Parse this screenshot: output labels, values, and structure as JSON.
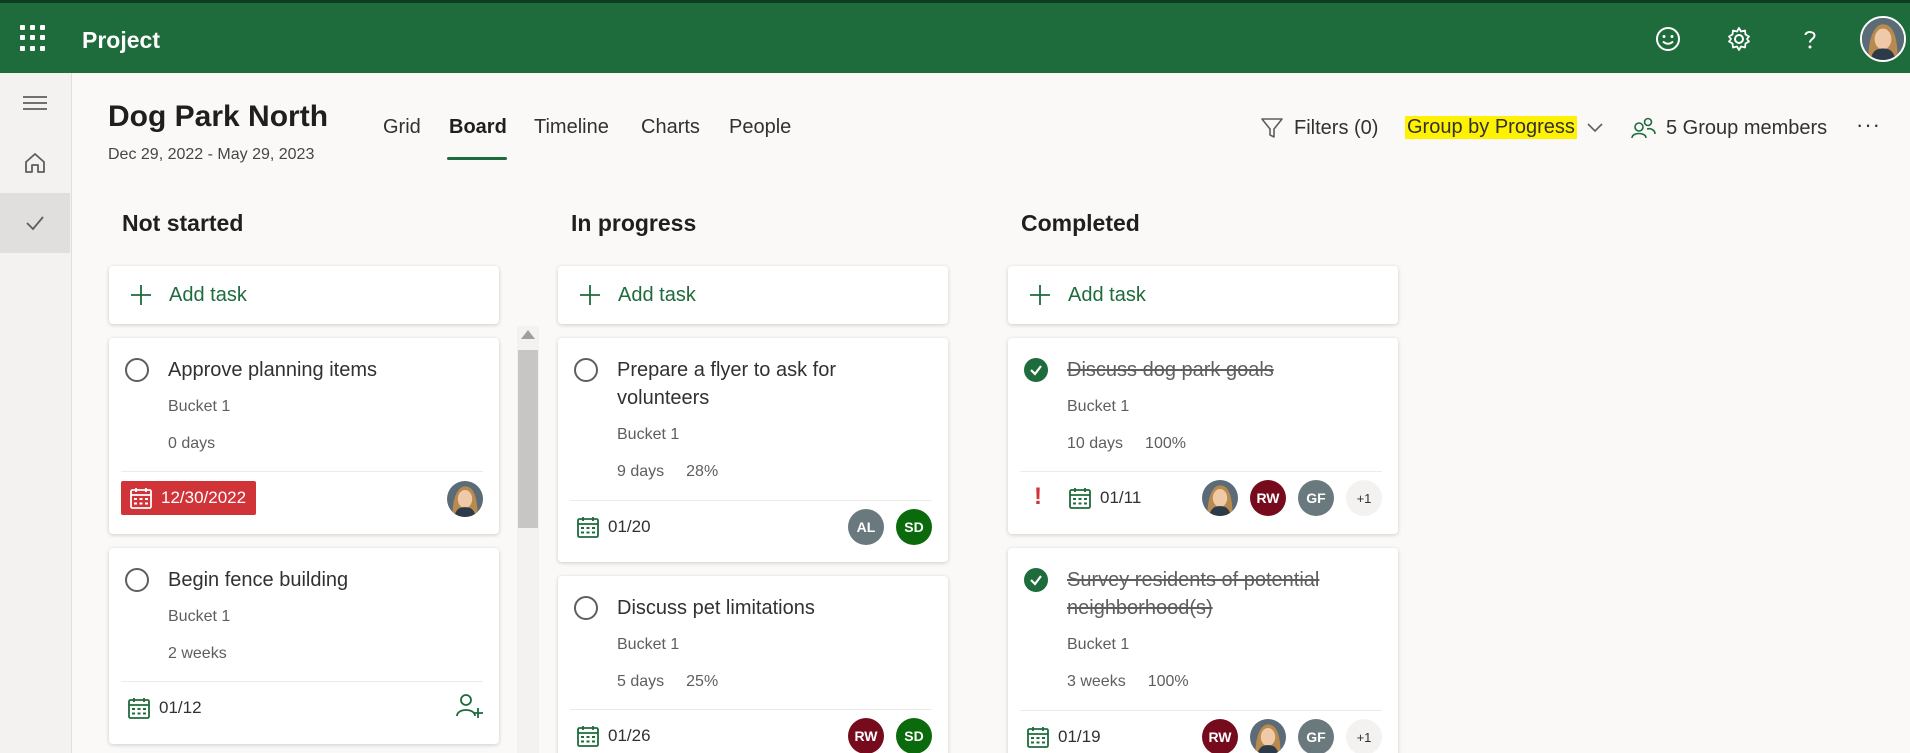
{
  "app": {
    "name": "Project"
  },
  "project": {
    "title": "Dog Park North",
    "dates": "Dec 29, 2022 - May 29, 2023"
  },
  "tabs": [
    {
      "label": "Grid",
      "active": false
    },
    {
      "label": "Board",
      "active": true
    },
    {
      "label": "Timeline",
      "active": false
    },
    {
      "label": "Charts",
      "active": false
    },
    {
      "label": "People",
      "active": false
    }
  ],
  "toolbar": {
    "filters_label": "Filters (0)",
    "group_by_label": "Group by Progress",
    "members_label": "5 Group members",
    "more_label": "···"
  },
  "topbar_icons": [
    "waffle-icon",
    "smiley-icon",
    "gear-icon",
    "help-icon",
    "profile-avatar"
  ],
  "colors": {
    "brand": "#1e6b3c",
    "overdue": "#d13438",
    "highlight": "#fff200"
  },
  "columns": [
    {
      "title": "Not started",
      "add_task_label": "Add task",
      "cards": [
        {
          "title": "Approve planning items",
          "bucket": "Bucket 1",
          "duration": "0 days",
          "due": "12/30/2022",
          "overdue": true
        },
        {
          "title": "Begin fence building",
          "bucket": "Bucket 1",
          "duration": "2 weeks",
          "due": "01/12"
        }
      ]
    },
    {
      "title": "In progress",
      "add_task_label": "Add task",
      "cards": [
        {
          "title": "Prepare a flyer to ask for volunteers",
          "bucket": "Bucket 1",
          "duration": "9 days",
          "percent": "28%",
          "due": "01/20",
          "assignees": [
            "AL",
            "SD"
          ]
        },
        {
          "title": "Discuss pet limitations",
          "bucket": "Bucket 1",
          "duration": "5 days",
          "percent": "25%",
          "due": "01/26",
          "assignees": [
            "RW",
            "SD"
          ]
        }
      ]
    },
    {
      "title": "Completed",
      "add_task_label": "Add task",
      "cards": [
        {
          "title": "Discuss dog park goals",
          "bucket": "Bucket 1",
          "duration": "10 days",
          "percent": "100%",
          "priority": "!",
          "due": "01/11",
          "assignees": [
            "RW",
            "GF"
          ],
          "more": "+1"
        },
        {
          "title": "Survey residents of potential neighborhood(s)",
          "bucket": "Bucket 1",
          "duration": "3 weeks",
          "percent": "100%",
          "due": "01/19",
          "assignees": [
            "RW",
            "GF"
          ],
          "more": "+1"
        }
      ]
    }
  ]
}
